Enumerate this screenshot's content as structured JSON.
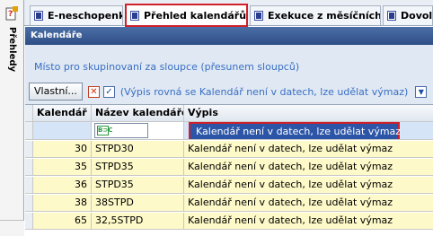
{
  "side": {
    "label": "Přehledy",
    "icon": "help-question-icon"
  },
  "tabs": [
    {
      "label": "E-neschopenky",
      "icon": "document-icon",
      "active": false
    },
    {
      "label": "Přehled kalendářů",
      "icon": "document-icon",
      "active": true,
      "close": "✕"
    },
    {
      "label": "Exekuce z měsíčních dat",
      "icon": "document-icon",
      "active": false
    },
    {
      "label": "Dovole",
      "icon": "document-icon",
      "active": false
    }
  ],
  "panel": {
    "title": "Kalendáře",
    "group_hint": "Místo pro skupinovaní za sloupce (přesunem sloupců)",
    "filter": {
      "custom_button": "Vlastní...",
      "clear_icon": "✕",
      "check_icon": "✓",
      "expression": "(Výpis rovná se Kalendář není v datech, lze udělat výmaz)",
      "dropdown_icon": "chevron-down-icon"
    }
  },
  "grid": {
    "columns": [
      "Kalendář",
      "Název kalendáře",
      "Výpis"
    ],
    "filter_row": {
      "value": "Kalendář není v datech, lze udělat výmaz"
    },
    "rows": [
      {
        "id": "30",
        "name": "STPD30",
        "note": "Kalendář není v datech, lze udělat výmaz"
      },
      {
        "id": "35",
        "name": "STPD35",
        "note": "Kalendář není v datech, lze udělat výmaz"
      },
      {
        "id": "36",
        "name": "STPD35",
        "note": "Kalendář není v datech, lze udělat výmaz"
      },
      {
        "id": "38",
        "name": "38STPD",
        "note": "Kalendář není v datech, lze udělat výmaz"
      },
      {
        "id": "65",
        "name": "32,5STPD",
        "note": "Kalendář není v datech, lze udělat výmaz"
      }
    ]
  }
}
